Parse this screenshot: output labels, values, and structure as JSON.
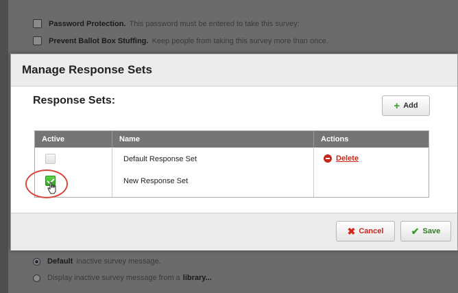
{
  "background": {
    "top_options": [
      {
        "bold": "Password Protection.",
        "text": "This password must be entered to take this survey:"
      },
      {
        "bold": "Prevent Ballot Box Stuffing.",
        "text": "Keep people from taking this survey more than once."
      }
    ],
    "bottom_options": [
      {
        "selected": true,
        "bold": "Default",
        "text": "inactive survey message."
      },
      {
        "selected": false,
        "text": "Display inactive survey message from a",
        "bold_tail": "library..."
      }
    ]
  },
  "modal": {
    "title": "Manage Response Sets",
    "section_title": "Response Sets:",
    "add_label": "Add",
    "table": {
      "headers": [
        "Active",
        "Name",
        "Actions"
      ],
      "rows": [
        {
          "active": false,
          "name": "Default Response Set",
          "action": "Delete"
        },
        {
          "active": true,
          "name": "New Response Set",
          "action": ""
        }
      ]
    },
    "cancel_label": "Cancel",
    "save_label": "Save"
  },
  "colors": {
    "accent_green": "#3a9a2a",
    "danger_red": "#c8261c",
    "header_gray": "#757575",
    "highlight_circle": "#d8463c"
  },
  "icons": [
    "checkbox-icon",
    "plus-icon",
    "minus-circle-icon",
    "pointer-cursor-icon",
    "x-icon",
    "checkmark-icon"
  ]
}
